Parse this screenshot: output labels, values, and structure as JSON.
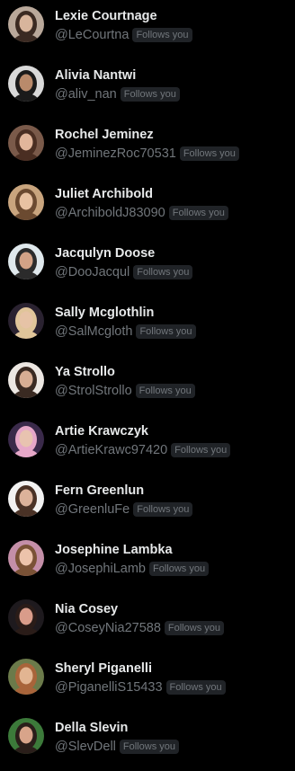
{
  "users": [
    {
      "name": "Lexie Courtnage",
      "handle": "@LeCourtna",
      "badge": "Follows you",
      "avatar": {
        "icon": "avatar-photo",
        "bg": "#b9a89a",
        "hair": "#3b2a22",
        "skin": "#d8b59c"
      }
    },
    {
      "name": "Alivia Nantwi",
      "handle": "@aliv_nan",
      "badge": "Follows you",
      "avatar": {
        "icon": "avatar-photo",
        "bg": "#d9d9d9",
        "hair": "#1a1a1a",
        "skin": "#b98a6b"
      }
    },
    {
      "name": "Rochel Jeminez",
      "handle": "@JeminezRoc70531",
      "badge": "Follows you",
      "avatar": {
        "icon": "avatar-photo",
        "bg": "#7a5a4a",
        "hair": "#4a2e22",
        "skin": "#e2b69b"
      }
    },
    {
      "name": "Juliet Archibold",
      "handle": "@ArchiboldJ83090",
      "badge": "Follows you",
      "avatar": {
        "icon": "avatar-photo",
        "bg": "#c9a57e",
        "hair": "#6b4a30",
        "skin": "#e8c2a2"
      }
    },
    {
      "name": "Jacqulyn Doose",
      "handle": "@DooJacqul",
      "badge": "Follows you",
      "avatar": {
        "icon": "avatar-photo",
        "bg": "#dfe8ec",
        "hair": "#2b2b2b",
        "skin": "#d2a286"
      }
    },
    {
      "name": "Sally Mcglothlin",
      "handle": "@SalMcgloth",
      "badge": "Follows you",
      "avatar": {
        "icon": "avatar-photo",
        "bg": "#2a2230",
        "hair": "#e0c59a",
        "skin": "#e6c3a6"
      }
    },
    {
      "name": "Ya Strollo",
      "handle": "@StrolStrollo",
      "badge": "Follows you",
      "avatar": {
        "icon": "avatar-photo",
        "bg": "#ece7e2",
        "hair": "#3a2a22",
        "skin": "#d7ad93"
      }
    },
    {
      "name": "Artie Krawczyk",
      "handle": "@ArtieKrawc97420",
      "badge": "Follows you",
      "avatar": {
        "icon": "avatar-photo",
        "bg": "#3a2a4a",
        "hair": "#e6a7c8",
        "skin": "#e8c3b0"
      }
    },
    {
      "name": "Fern Greenlun",
      "handle": "@GreenluFe",
      "badge": "Follows you",
      "avatar": {
        "icon": "avatar-photo",
        "bg": "#f2f2f2",
        "hair": "#4a3226",
        "skin": "#dcb29a"
      }
    },
    {
      "name": "Josephine Lambka",
      "handle": "@JosephiLamb",
      "badge": "Follows you",
      "avatar": {
        "icon": "avatar-photo",
        "bg": "#c48fa8",
        "hair": "#7a5236",
        "skin": "#ecc3ab"
      }
    },
    {
      "name": "Nia Cosey",
      "handle": "@CoseyNia27588",
      "badge": "Follows you",
      "avatar": {
        "icon": "avatar-photo",
        "bg": "#1e1a1e",
        "hair": "#2a1c18",
        "skin": "#d99c8a"
      }
    },
    {
      "name": "Sheryl Piganelli",
      "handle": "@PiganelliS15433",
      "badge": "Follows you",
      "avatar": {
        "icon": "avatar-photo",
        "bg": "#6b7a4a",
        "hair": "#a8643a",
        "skin": "#e2b592"
      }
    },
    {
      "name": "Della Slevin",
      "handle": "@SlevDell",
      "badge": "Follows you",
      "avatar": {
        "icon": "avatar-photo",
        "bg": "#3c7a3a",
        "hair": "#2a1e1a",
        "skin": "#d8a48a"
      }
    }
  ]
}
